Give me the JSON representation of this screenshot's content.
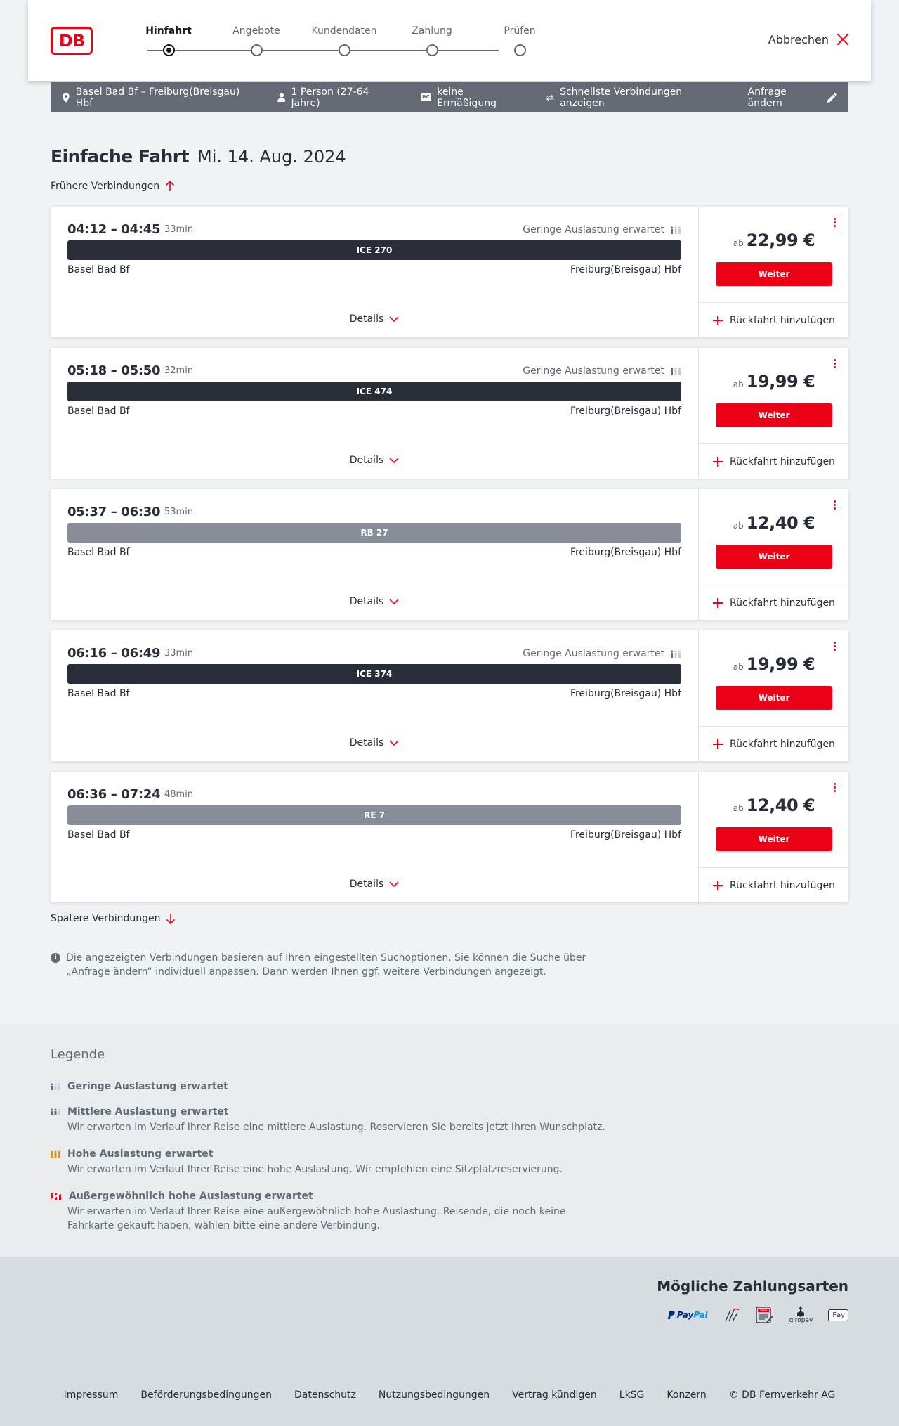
{
  "header": {
    "logo_text": "DB",
    "steps": [
      {
        "label": "Hinfahrt",
        "active": true
      },
      {
        "label": "Angebote",
        "active": false
      },
      {
        "label": "Kundendaten",
        "active": false
      },
      {
        "label": "Zahlung",
        "active": false
      },
      {
        "label": "Prüfen",
        "active": false
      }
    ],
    "cancel_label": "Abbrechen"
  },
  "search": {
    "route": "Basel Bad Bf – Freiburg(Breisgau) Hbf",
    "passengers": "1 Person (27-64 Jahre)",
    "discount_badge": "BC",
    "discount": "keine Ermäßigung",
    "option": "Schnellste Verbindungen anzeigen",
    "edit_label": "Anfrage ändern"
  },
  "page": {
    "title": "Einfache Fahrt",
    "date": "Mi. 14. Aug. 2024",
    "earlier_label": "Frühere Verbindungen",
    "later_label": "Spätere Verbindungen",
    "info_text": "Die angezeigten Verbindungen basieren auf Ihren eingestellten Suchoptionen. Sie können die Suche über „Anfrage ändern“ individuell anpassen. Dann werden Ihnen ggf. weitere Verbindungen angezeigt."
  },
  "connections": [
    {
      "times": "04:12 – 04:45",
      "sep": "|",
      "duration": "33min",
      "load": "Geringe Auslastung erwartet",
      "train": "ICE 270",
      "regional": false,
      "from": "Basel Bad Bf",
      "to": "Freiburg(Breisgau) Hbf",
      "price_prefix": "ab",
      "price": "22,99 €",
      "button": "Weiter",
      "details": "Details",
      "return": "Rückfahrt hinzufügen"
    },
    {
      "times": "05:18 – 05:50",
      "sep": "|",
      "duration": "32min",
      "load": "Geringe Auslastung erwartet",
      "train": "ICE 474",
      "regional": false,
      "from": "Basel Bad Bf",
      "to": "Freiburg(Breisgau) Hbf",
      "price_prefix": "ab",
      "price": "19,99 €",
      "button": "Weiter",
      "details": "Details",
      "return": "Rückfahrt hinzufügen"
    },
    {
      "times": "05:37 – 06:30",
      "sep": "|",
      "duration": "53min",
      "load": "",
      "train": "RB 27",
      "regional": true,
      "from": "Basel Bad Bf",
      "to": "Freiburg(Breisgau) Hbf",
      "price_prefix": "ab",
      "price": "12,40 €",
      "button": "Weiter",
      "details": "Details",
      "return": "Rückfahrt hinzufügen"
    },
    {
      "times": "06:16 – 06:49",
      "sep": "|",
      "duration": "33min",
      "load": "Geringe Auslastung erwartet",
      "train": "ICE 374",
      "regional": false,
      "from": "Basel Bad Bf",
      "to": "Freiburg(Breisgau) Hbf",
      "price_prefix": "ab",
      "price": "19,99 €",
      "button": "Weiter",
      "details": "Details",
      "return": "Rückfahrt hinzufügen"
    },
    {
      "times": "06:36 – 07:24",
      "sep": "|",
      "duration": "48min",
      "load": "",
      "train": "RE 7",
      "regional": true,
      "from": "Basel Bad Bf",
      "to": "Freiburg(Breisgau) Hbf",
      "price_prefix": "ab",
      "price": "12,40 €",
      "button": "Weiter",
      "details": "Details",
      "return": "Rückfahrt hinzufügen"
    }
  ],
  "legend": {
    "title": "Legende",
    "items": [
      {
        "title": "Geringe Auslastung erwartet",
        "text": "",
        "color": "#646973",
        "icon": "load-low-icon"
      },
      {
        "title": "Mittlere Auslastung erwartet",
        "text": "Wir erwarten im Verlauf Ihrer Reise eine mittlere Auslastung. Reservieren Sie bereits jetzt Ihren Wunschplatz.",
        "color": "#646973",
        "icon": "load-medium-icon"
      },
      {
        "title": "Hohe Auslastung erwartet",
        "text": "Wir erwarten im Verlauf Ihrer Reise eine hohe Auslastung. Wir empfehlen eine Sitzplatzreservierung.",
        "color": "#f39200",
        "icon": "load-high-icon"
      },
      {
        "title": "Außergewöhnlich hohe Auslastung erwartet",
        "text": "Wir erwarten im Verlauf Ihrer Reise eine außergewöhnlich hohe Auslastung. Reisende, die noch keine Fahrkarte gekauft haben, wählen bitte eine andere Verbindung.",
        "color": "#ec0016",
        "icon": "load-extreme-icon"
      }
    ]
  },
  "payment": {
    "title": "Mögliche Zahlungsarten",
    "paypal_a": "Pay",
    "paypal_b": "Pal",
    "sepa": "SEPA",
    "giropay": "giropay",
    "applepay": "Pay"
  },
  "footer": {
    "links": [
      "Impressum",
      "Beförderungsbedingungen",
      "Datenschutz",
      "Nutzungsbedingungen",
      "Vertrag kündigen",
      "LkSG",
      "Konzern"
    ],
    "copyright": "© DB Fernverkehr AG"
  },
  "colors": {
    "accent": "#ec0016",
    "dark": "#282d37",
    "regional": "#878c96",
    "bar": "#646973"
  }
}
